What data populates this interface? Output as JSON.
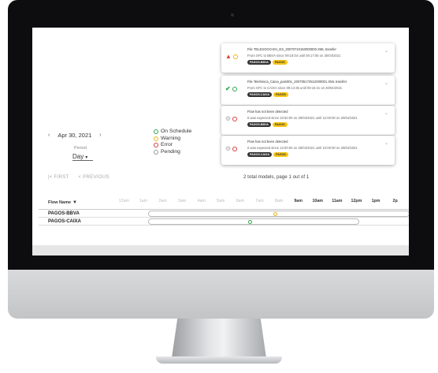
{
  "calendar": {
    "prev": "‹",
    "date": "Apr 30, 2021",
    "next": "›",
    "period_label": "Period",
    "period_value": "Day"
  },
  "legend": [
    {
      "label": "On Schedule",
      "color": "#2ea84d"
    },
    {
      "label": "Warning",
      "color": "#e7b416"
    },
    {
      "label": "Error",
      "color": "#d93f3f"
    },
    {
      "label": "Pending",
      "color": "#999999"
    }
  ],
  "pagination": {
    "first": "|< FIRST",
    "previous": "< PREVIOUS",
    "summary": "2 total models, page 1 out of 1"
  },
  "table": {
    "flow_header": "Flow Name",
    "hours": [
      "12am",
      "1am",
      "2am",
      "3am",
      "4am",
      "5am",
      "6am",
      "7am",
      "8am",
      "9am",
      "10am",
      "11am",
      "12pm",
      "1pm",
      "2p"
    ],
    "rows": [
      {
        "name": "PAGOS-BBVA",
        "status_color": "#e7b416"
      },
      {
        "name": "PAGOS-CAIXA",
        "status_color": "#2ea84d"
      }
    ]
  },
  "notifications": [
    {
      "line1": "File TELESOGO-EH_ES_20070710150000000.XML transfer",
      "line2": "From SFC to BBVA since 09:16:04 until 09:17:06 on 30/04/2021",
      "chip1": "PAGOS-BBVA",
      "chip2": "PAGOS",
      "icon_a": "warning-triangle-icon",
      "icon_b": "warning-dot-icon"
    },
    {
      "line1": "File Telefonica_Caixa_pain001_200705172512000001.XML transfer",
      "line2": "From SFC to CAIXA since 09:14:35 until 09:15:31 on 30/04/2021",
      "chip1": "PAGOS-CAIXA",
      "chip2": "PAGOS",
      "icon_a": "check-icon",
      "icon_b": "on-schedule-dot-icon"
    },
    {
      "line1": "Flow has not been detected",
      "line2": "It was expected since 23:50:00 on 28/04/2021 until 12:00:00 on 29/04/2021",
      "chip1": "PAGOS-BBVA",
      "chip2": "PAGOS",
      "icon_a": "gear-icon",
      "icon_b": "error-dot-icon"
    },
    {
      "line1": "Flow has not been detected",
      "line2": "It was expected since 14:00:00 on 28/04/2021 until 10:00:00 on 29/04/2021",
      "chip1": "PAGOS-CAIXA",
      "chip2": "PAGOS",
      "icon_a": "gear-icon",
      "icon_b": "error-dot-icon"
    }
  ]
}
